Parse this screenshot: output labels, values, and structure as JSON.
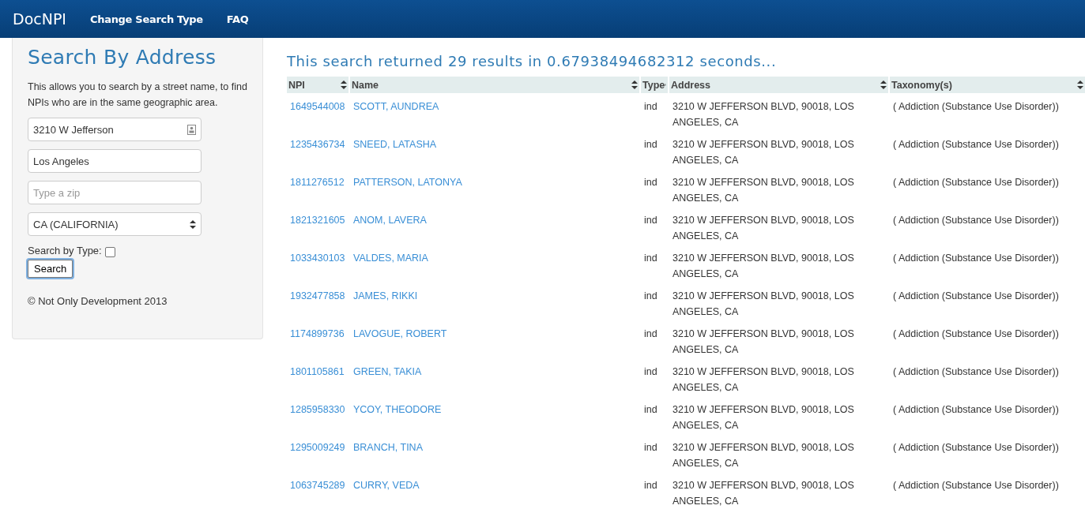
{
  "navbar": {
    "brand": "DocNPI",
    "links": [
      "Change Search Type",
      "FAQ"
    ]
  },
  "sidebar": {
    "title": "Search By Address",
    "description": "This allows you to search by a street name, to find NPIs who are in the same geographic area.",
    "street": {
      "value": "3210 W Jefferson"
    },
    "city": {
      "value": "Los Angeles"
    },
    "zip": {
      "placeholder": "Type a zip"
    },
    "state": {
      "value": "CA (CALIFORNIA)"
    },
    "type_filter": {
      "label": "Search by Type:",
      "checked": false
    },
    "search_button": "Search",
    "footer": "© Not Only Development 2013"
  },
  "results": {
    "summary": "This search returned 29 results in 0.67938494682312 seconds...",
    "columns": [
      "NPI",
      "Name",
      "Type",
      "Address",
      "Taxonomy(s)"
    ],
    "rows": [
      {
        "npi": "1649544008",
        "name": "SCOTT, AUNDREA",
        "type": "ind",
        "address": "3210 W JEFFERSON BLVD, 90018, LOS ANGELES, CA",
        "taxonomy": "( Addiction (Substance Use Disorder))"
      },
      {
        "npi": "1235436734",
        "name": "SNEED, LATASHA",
        "type": "ind",
        "address": "3210 W JEFFERSON BLVD, 90018, LOS ANGELES, CA",
        "taxonomy": "( Addiction (Substance Use Disorder))"
      },
      {
        "npi": "1811276512",
        "name": "PATTERSON, LATONYA",
        "type": "ind",
        "address": "3210 W JEFFERSON BLVD, 90018, LOS ANGELES, CA",
        "taxonomy": "( Addiction (Substance Use Disorder))"
      },
      {
        "npi": "1821321605",
        "name": "ANOM, LAVERA",
        "type": "ind",
        "address": "3210 W JEFFERSON BLVD, 90018, LOS ANGELES, CA",
        "taxonomy": "( Addiction (Substance Use Disorder))"
      },
      {
        "npi": "1033430103",
        "name": "VALDES, MARIA",
        "type": "ind",
        "address": "3210 W JEFFERSON BLVD, 90018, LOS ANGELES, CA",
        "taxonomy": "( Addiction (Substance Use Disorder))"
      },
      {
        "npi": "1932477858",
        "name": "JAMES, RIKKI",
        "type": "ind",
        "address": "3210 W JEFFERSON BLVD, 90018, LOS ANGELES, CA",
        "taxonomy": "( Addiction (Substance Use Disorder))"
      },
      {
        "npi": "1174899736",
        "name": "LAVOGUE, ROBERT",
        "type": "ind",
        "address": "3210 W JEFFERSON BLVD, 90018, LOS ANGELES, CA",
        "taxonomy": "( Addiction (Substance Use Disorder))"
      },
      {
        "npi": "1801105861",
        "name": "GREEN, TAKIA",
        "type": "ind",
        "address": "3210 W JEFFERSON BLVD, 90018, LOS ANGELES, CA",
        "taxonomy": "( Addiction (Substance Use Disorder))"
      },
      {
        "npi": "1285958330",
        "name": "YCOY, THEODORE",
        "type": "ind",
        "address": "3210 W JEFFERSON BLVD, 90018, LOS ANGELES, CA",
        "taxonomy": "( Addiction (Substance Use Disorder))"
      },
      {
        "npi": "1295009249",
        "name": "BRANCH, TINA",
        "type": "ind",
        "address": "3210 W JEFFERSON BLVD, 90018, LOS ANGELES, CA",
        "taxonomy": "( Addiction (Substance Use Disorder))"
      },
      {
        "npi": "1063745289",
        "name": "CURRY, VEDA",
        "type": "ind",
        "address": "3210 W JEFFERSON BLVD, 90018, LOS ANGELES, CA",
        "taxonomy": "( Addiction (Substance Use Disorder))"
      }
    ]
  }
}
